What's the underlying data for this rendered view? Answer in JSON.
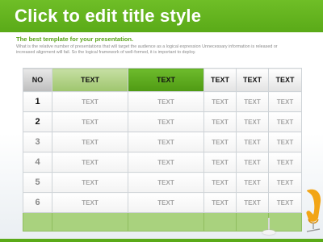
{
  "slide": {
    "title": "Click to edit title style",
    "subtitle": "The best template for your presentation.",
    "description": "What is the relative number of presentations that will target the audience as a logical expression Unnecessary information is released or increased alignment will fail. So the logical framework of well-formed, it is important to deploy."
  },
  "table": {
    "headers": [
      "NO",
      "TEXT",
      "TEXT",
      "TEXT",
      "TEXT",
      "TEXT"
    ],
    "rows": [
      {
        "no": "1",
        "cells": [
          "TEXT",
          "TEXT",
          "TEXT",
          "TEXT",
          "TEXT"
        ]
      },
      {
        "no": "2",
        "cells": [
          "TEXT",
          "TEXT",
          "TEXT",
          "TEXT",
          "TEXT"
        ]
      },
      {
        "no": "3",
        "cells": [
          "TEXT",
          "TEXT",
          "TEXT",
          "TEXT",
          "TEXT"
        ]
      },
      {
        "no": "4",
        "cells": [
          "TEXT",
          "TEXT",
          "TEXT",
          "TEXT",
          "TEXT"
        ]
      },
      {
        "no": "5",
        "cells": [
          "TEXT",
          "TEXT",
          "TEXT",
          "TEXT",
          "TEXT"
        ]
      },
      {
        "no": "6",
        "cells": [
          "TEXT",
          "TEXT",
          "TEXT",
          "TEXT",
          "TEXT"
        ]
      }
    ],
    "row_number_colors": [
      "#111111",
      "#111111",
      "#888888",
      "#888888",
      "#888888",
      "#888888"
    ]
  },
  "colors": {
    "accent_green": "#5aaa18",
    "light_green": "#a9d27e",
    "chair_orange": "#f2a516"
  },
  "icons": {
    "lamp": "floor-lamp-icon",
    "chair": "chair-icon"
  }
}
